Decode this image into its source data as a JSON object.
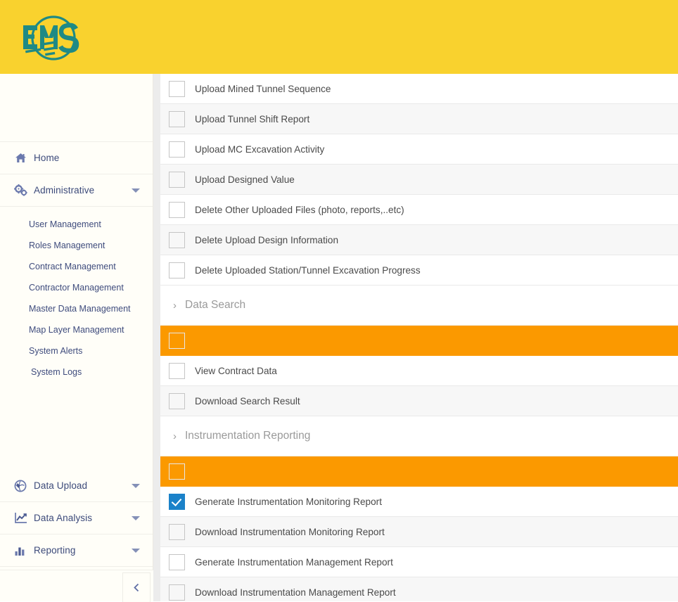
{
  "app": {
    "logo_text": "EMS",
    "logo_color": "#1f8a85",
    "header_color": "#f9d22e"
  },
  "colors": {
    "header_yellow": "#f9d22e",
    "highlight_orange": "#fb9900",
    "checkbox_blue": "#1b82c9",
    "sidebar_text": "#3c4a7a",
    "row_text": "#4a4a4a",
    "section_text": "#9a9a9a"
  },
  "sidebar": {
    "groups": [
      {
        "label": "Home",
        "icon": "home-icon",
        "has_caret": false
      },
      {
        "label": "Administrative",
        "icon": "cogs-icon",
        "has_caret": true
      },
      {
        "label": "Data Upload",
        "icon": "upload-globe-icon",
        "has_caret": true
      },
      {
        "label": "Data Analysis",
        "icon": "line-chart-icon",
        "has_caret": true
      },
      {
        "label": "Reporting",
        "icon": "bar-chart-icon",
        "has_caret": true
      }
    ],
    "administrative_items": [
      "User Management",
      "Roles Management",
      "Contract Management",
      "Contractor Management",
      "Master Data Management",
      "Map Layer Management",
      "System Alerts",
      "System Logs"
    ],
    "collapse_button": {
      "icon": "chevron-left-icon",
      "label": ""
    }
  },
  "main": {
    "rows": [
      {
        "label": "Upload Mined Tunnel Sequence",
        "checked": false,
        "type": "item",
        "alt": false
      },
      {
        "label": "Upload Tunnel Shift Report",
        "checked": false,
        "type": "item",
        "alt": true
      },
      {
        "label": "Upload MC Excavation Activity",
        "checked": false,
        "type": "item",
        "alt": false
      },
      {
        "label": "Upload Designed Value",
        "checked": false,
        "type": "item",
        "alt": true
      },
      {
        "label": "Delete Other Uploaded Files (photo, reports,..etc)",
        "checked": false,
        "type": "item",
        "alt": false
      },
      {
        "label": "Delete Upload Design Information",
        "checked": false,
        "type": "item",
        "alt": true
      },
      {
        "label": "Delete Uploaded Station/Tunnel Excavation Progress",
        "checked": false,
        "type": "item",
        "alt": false
      },
      {
        "label": "Data Search",
        "checked": false,
        "type": "section",
        "alt": false
      },
      {
        "label": "",
        "checked": false,
        "type": "orange",
        "alt": false
      },
      {
        "label": "View Contract Data",
        "checked": false,
        "type": "item",
        "alt": false
      },
      {
        "label": "Download Search Result",
        "checked": false,
        "type": "item",
        "alt": true
      },
      {
        "label": "Instrumentation Reporting",
        "checked": false,
        "type": "section",
        "alt": false
      },
      {
        "label": "",
        "checked": false,
        "type": "orange",
        "alt": false
      },
      {
        "label": "Generate Instrumentation Monitoring Report",
        "checked": true,
        "type": "item",
        "alt": false
      },
      {
        "label": "Download Instrumentation Monitoring Report",
        "checked": false,
        "type": "item",
        "alt": true
      },
      {
        "label": "Generate Instrumentation Management Report",
        "checked": false,
        "type": "item",
        "alt": false
      },
      {
        "label": "Download Instrumentation Management Report",
        "checked": false,
        "type": "item",
        "alt": true
      }
    ],
    "section_chevron": "›"
  }
}
